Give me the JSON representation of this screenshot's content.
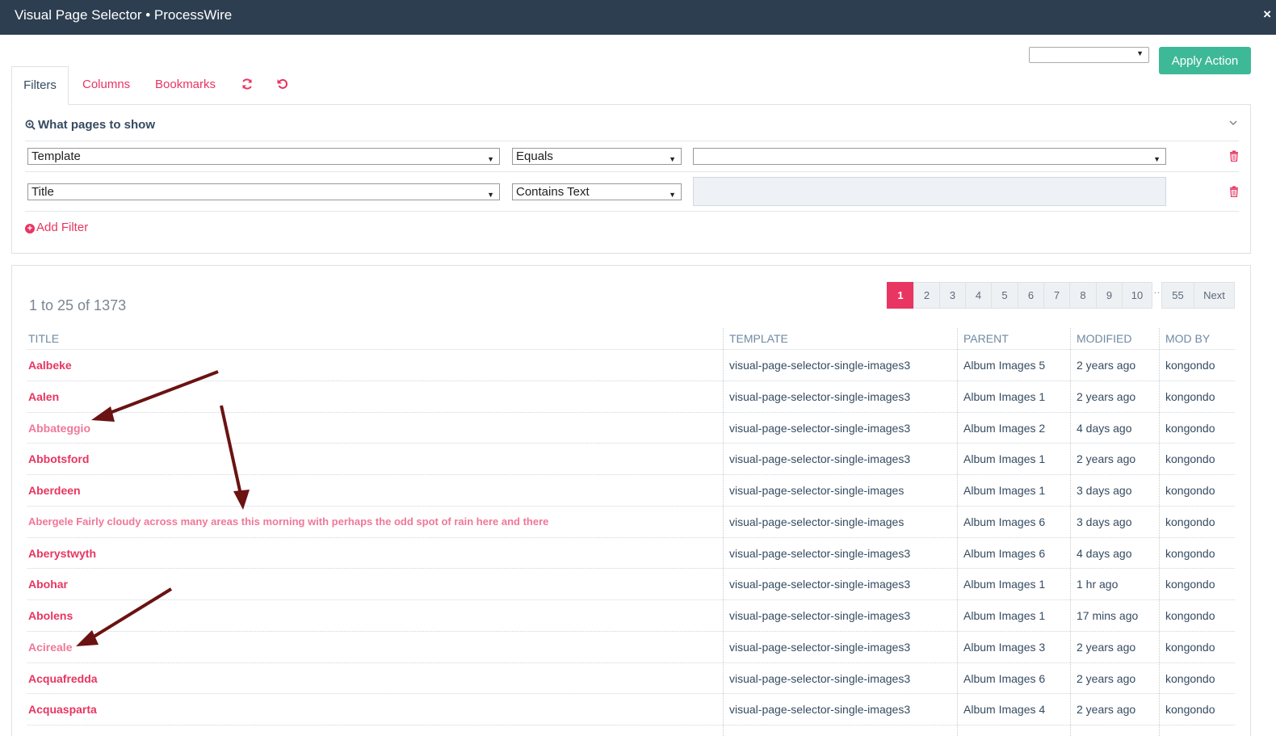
{
  "window": {
    "title": "Visual Page Selector • ProcessWire",
    "close_icon": "×"
  },
  "toolbar": {
    "action_select_value": "",
    "apply_label": "Apply Action"
  },
  "tabs": [
    {
      "label": "Filters"
    },
    {
      "label": "Columns"
    },
    {
      "label": "Bookmarks"
    }
  ],
  "filters": {
    "heading": "What pages to show",
    "rows": [
      {
        "field": "Template",
        "operator": "Equals",
        "value": ""
      },
      {
        "field": "Title",
        "operator": "Contains Text",
        "value": ""
      }
    ],
    "add_label": "Add Filter"
  },
  "results": {
    "count_text": "1 to 25 of 1373",
    "pagination": [
      "1",
      "2",
      "3",
      "4",
      "5",
      "6",
      "7",
      "8",
      "9",
      "10",
      "…",
      "55",
      "Next"
    ],
    "active_page": "1",
    "columns": [
      "TITLE",
      "TEMPLATE",
      "PARENT",
      "MODIFIED",
      "MOD BY"
    ],
    "rows": [
      {
        "title": "Aalbeke",
        "template": "visual-page-selector-single-images3",
        "parent": "Album Images 5",
        "modified": "2 years ago",
        "mod_by": "kongondo"
      },
      {
        "title": "Aalen",
        "template": "visual-page-selector-single-images3",
        "parent": "Album Images 1",
        "modified": "2 years ago",
        "mod_by": "kongondo"
      },
      {
        "title": "Abbateggio",
        "template": "visual-page-selector-single-images3",
        "parent": "Album Images 2",
        "modified": "4 days ago",
        "mod_by": "kongondo"
      },
      {
        "title": "Abbotsford",
        "template": "visual-page-selector-single-images3",
        "parent": "Album Images 1",
        "modified": "2 years ago",
        "mod_by": "kongondo"
      },
      {
        "title": "Aberdeen",
        "template": "visual-page-selector-single-images",
        "parent": "Album Images 1",
        "modified": "3 days ago",
        "mod_by": "kongondo"
      },
      {
        "title": "Abergele Fairly cloudy across many areas this morning with perhaps the odd spot of rain here and there",
        "template": "visual-page-selector-single-images",
        "parent": "Album Images 6",
        "modified": "3 days ago",
        "mod_by": "kongondo"
      },
      {
        "title": "Aberystwyth",
        "template": "visual-page-selector-single-images3",
        "parent": "Album Images 6",
        "modified": "4 days ago",
        "mod_by": "kongondo"
      },
      {
        "title": "Abohar",
        "template": "visual-page-selector-single-images3",
        "parent": "Album Images 1",
        "modified": "1 hr ago",
        "mod_by": "kongondo"
      },
      {
        "title": "Abolens",
        "template": "visual-page-selector-single-images3",
        "parent": "Album Images 1",
        "modified": "17 mins ago",
        "mod_by": "kongondo"
      },
      {
        "title": "Acireale",
        "template": "visual-page-selector-single-images3",
        "parent": "Album Images 3",
        "modified": "2 years ago",
        "mod_by": "kongondo"
      },
      {
        "title": "Acquafredda",
        "template": "visual-page-selector-single-images3",
        "parent": "Album Images 6",
        "modified": "2 years ago",
        "mod_by": "kongondo"
      },
      {
        "title": "Acquasparta",
        "template": "visual-page-selector-single-images3",
        "parent": "Album Images 4",
        "modified": "2 years ago",
        "mod_by": "kongondo"
      }
    ]
  },
  "icons": {
    "refresh": "refresh-icon",
    "reset": "undo-icon",
    "search": "search-plus-icon",
    "trash": "trash-icon",
    "add": "plus-circle-icon",
    "collapse": "chevron-down-icon"
  },
  "colors": {
    "topbar": "#2c3e50",
    "accent": "#e83561",
    "apply": "#3eb998",
    "annotation_arrow": "#6b1212"
  }
}
